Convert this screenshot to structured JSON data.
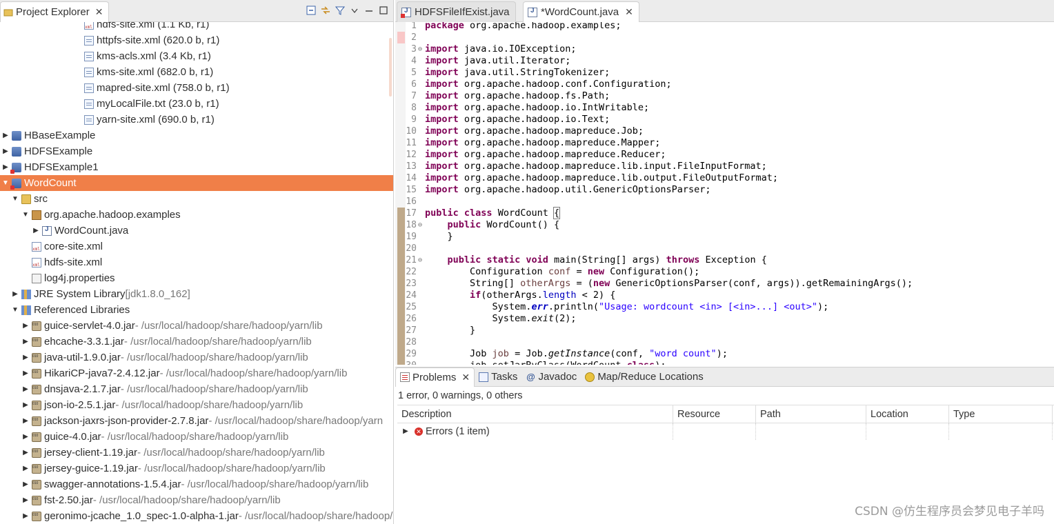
{
  "explorer": {
    "title": "Project Explorer",
    "tree": [
      {
        "indent": 105,
        "arrow": "",
        "icon": "xml",
        "name": "hdfs-site.xml (1.1 Kb, r1)",
        "suffix": ""
      },
      {
        "indent": 105,
        "arrow": "",
        "icon": "file",
        "name": "httpfs-site.xml (620.0 b, r1)",
        "suffix": ""
      },
      {
        "indent": 105,
        "arrow": "",
        "icon": "file",
        "name": "kms-acls.xml (3.4 Kb, r1)",
        "suffix": ""
      },
      {
        "indent": 105,
        "arrow": "",
        "icon": "file",
        "name": "kms-site.xml (682.0 b, r1)",
        "suffix": ""
      },
      {
        "indent": 105,
        "arrow": "",
        "icon": "file",
        "name": "mapred-site.xml (758.0 b, r1)",
        "suffix": ""
      },
      {
        "indent": 105,
        "arrow": "",
        "icon": "file",
        "name": "myLocalFile.txt (23.0 b, r1)",
        "suffix": ""
      },
      {
        "indent": 105,
        "arrow": "",
        "icon": "file",
        "name": "yarn-site.xml (690.0 b, r1)",
        "suffix": ""
      },
      {
        "indent": 0,
        "arrow": "▶",
        "icon": "project",
        "name": "HBaseExample",
        "suffix": ""
      },
      {
        "indent": 0,
        "arrow": "▶",
        "icon": "project",
        "name": "HDFSExample",
        "suffix": ""
      },
      {
        "indent": 0,
        "arrow": "▶",
        "icon": "project-err",
        "name": "HDFSExample1",
        "suffix": ""
      },
      {
        "indent": 0,
        "arrow": "▼",
        "icon": "project-err",
        "name": "WordCount",
        "suffix": "",
        "selected": true
      },
      {
        "indent": 14,
        "arrow": "▼",
        "icon": "folder",
        "name": "src",
        "suffix": ""
      },
      {
        "indent": 29,
        "arrow": "▼",
        "icon": "package",
        "name": "org.apache.hadoop.examples",
        "suffix": ""
      },
      {
        "indent": 44,
        "arrow": "▶",
        "icon": "java",
        "name": "WordCount.java",
        "suffix": ""
      },
      {
        "indent": 29,
        "arrow": "",
        "icon": "xml",
        "name": "core-site.xml",
        "suffix": ""
      },
      {
        "indent": 29,
        "arrow": "",
        "icon": "xml",
        "name": "hdfs-site.xml",
        "suffix": ""
      },
      {
        "indent": 29,
        "arrow": "",
        "icon": "props",
        "name": "log4j.properties",
        "suffix": ""
      },
      {
        "indent": 14,
        "arrow": "▶",
        "icon": "lib",
        "name": "JRE System Library ",
        "suffix": "[jdk1.8.0_162]"
      },
      {
        "indent": 14,
        "arrow": "▼",
        "icon": "lib",
        "name": "Referenced Libraries",
        "suffix": ""
      },
      {
        "indent": 29,
        "arrow": "▶",
        "icon": "jar",
        "name": "guice-servlet-4.0.jar",
        "suffix": " - /usr/local/hadoop/share/hadoop/yarn/lib"
      },
      {
        "indent": 29,
        "arrow": "▶",
        "icon": "jar",
        "name": "ehcache-3.3.1.jar",
        "suffix": " - /usr/local/hadoop/share/hadoop/yarn/lib"
      },
      {
        "indent": 29,
        "arrow": "▶",
        "icon": "jar",
        "name": "java-util-1.9.0.jar",
        "suffix": " - /usr/local/hadoop/share/hadoop/yarn/lib"
      },
      {
        "indent": 29,
        "arrow": "▶",
        "icon": "jar",
        "name": "HikariCP-java7-2.4.12.jar",
        "suffix": " - /usr/local/hadoop/share/hadoop/yarn/lib"
      },
      {
        "indent": 29,
        "arrow": "▶",
        "icon": "jar",
        "name": "dnsjava-2.1.7.jar",
        "suffix": " - /usr/local/hadoop/share/hadoop/yarn/lib"
      },
      {
        "indent": 29,
        "arrow": "▶",
        "icon": "jar",
        "name": "json-io-2.5.1.jar",
        "suffix": " - /usr/local/hadoop/share/hadoop/yarn/lib"
      },
      {
        "indent": 29,
        "arrow": "▶",
        "icon": "jar",
        "name": "jackson-jaxrs-json-provider-2.7.8.jar",
        "suffix": " - /usr/local/hadoop/share/hadoop/yarn"
      },
      {
        "indent": 29,
        "arrow": "▶",
        "icon": "jar",
        "name": "guice-4.0.jar",
        "suffix": " - /usr/local/hadoop/share/hadoop/yarn/lib"
      },
      {
        "indent": 29,
        "arrow": "▶",
        "icon": "jar",
        "name": "jersey-client-1.19.jar",
        "suffix": " - /usr/local/hadoop/share/hadoop/yarn/lib"
      },
      {
        "indent": 29,
        "arrow": "▶",
        "icon": "jar",
        "name": "jersey-guice-1.19.jar",
        "suffix": " - /usr/local/hadoop/share/hadoop/yarn/lib"
      },
      {
        "indent": 29,
        "arrow": "▶",
        "icon": "jar",
        "name": "swagger-annotations-1.5.4.jar",
        "suffix": " - /usr/local/hadoop/share/hadoop/yarn/lib"
      },
      {
        "indent": 29,
        "arrow": "▶",
        "icon": "jar",
        "name": "fst-2.50.jar",
        "suffix": " - /usr/local/hadoop/share/hadoop/yarn/lib"
      },
      {
        "indent": 29,
        "arrow": "▶",
        "icon": "jar",
        "name": "geronimo-jcache_1.0_spec-1.0-alpha-1.jar",
        "suffix": " - /usr/local/hadoop/share/hadoop/"
      }
    ]
  },
  "editor": {
    "tabs": [
      {
        "label": "HDFSFileIfExist.java",
        "active": false,
        "error": true
      },
      {
        "label": "*WordCount.java",
        "active": true,
        "error": false
      }
    ],
    "lines": [
      {
        "n": "1",
        "fold": "",
        "mark": "",
        "html": "<span class=\"kw\">package</span> org.apache.hadoop.examples;"
      },
      {
        "n": "2",
        "fold": "",
        "mark": "cur",
        "html": ""
      },
      {
        "n": "3",
        "fold": "⊖",
        "mark": "",
        "html": "<span class=\"kw\">import</span> java.io.IOException;"
      },
      {
        "n": "4",
        "fold": "",
        "mark": "",
        "html": "<span class=\"kw\">import</span> java.util.Iterator;"
      },
      {
        "n": "5",
        "fold": "",
        "mark": "",
        "html": "<span class=\"kw\">import</span> java.util.StringTokenizer;"
      },
      {
        "n": "6",
        "fold": "",
        "mark": "",
        "html": "<span class=\"kw\">import</span> org.apache.hadoop.conf.Configuration;"
      },
      {
        "n": "7",
        "fold": "",
        "mark": "",
        "html": "<span class=\"kw\">import</span> org.apache.hadoop.fs.Path;"
      },
      {
        "n": "8",
        "fold": "",
        "mark": "",
        "html": "<span class=\"kw\">import</span> org.apache.hadoop.io.IntWritable;"
      },
      {
        "n": "9",
        "fold": "",
        "mark": "",
        "html": "<span class=\"kw\">import</span> org.apache.hadoop.io.Text;"
      },
      {
        "n": "10",
        "fold": "",
        "mark": "",
        "html": "<span class=\"kw\">import</span> org.apache.hadoop.mapreduce.Job;"
      },
      {
        "n": "11",
        "fold": "",
        "mark": "",
        "html": "<span class=\"kw\">import</span> org.apache.hadoop.mapreduce.Mapper;"
      },
      {
        "n": "12",
        "fold": "",
        "mark": "",
        "html": "<span class=\"kw\">import</span> org.apache.hadoop.mapreduce.Reducer;"
      },
      {
        "n": "13",
        "fold": "",
        "mark": "",
        "html": "<span class=\"kw\">import</span> org.apache.hadoop.mapreduce.lib.input.FileInputFormat;"
      },
      {
        "n": "14",
        "fold": "",
        "mark": "",
        "html": "<span class=\"kw\">import</span> org.apache.hadoop.mapreduce.lib.output.FileOutputFormat;"
      },
      {
        "n": "15",
        "fold": "",
        "mark": "",
        "html": "<span class=\"kw\">import</span> org.apache.hadoop.util.GenericOptionsParser;"
      },
      {
        "n": "16",
        "fold": "",
        "mark": "",
        "html": ""
      },
      {
        "n": "17",
        "fold": "",
        "mark": "m",
        "html": "<span class=\"kw\">public</span> <span class=\"kw\">class</span> WordCount <span class=\"bracket\">{</span>"
      },
      {
        "n": "18",
        "fold": "⊖",
        "mark": "m",
        "html": "    <span class=\"kw\">public</span> WordCount() {"
      },
      {
        "n": "19",
        "fold": "",
        "mark": "m",
        "html": "    }"
      },
      {
        "n": "20",
        "fold": "",
        "mark": "m",
        "html": ""
      },
      {
        "n": "21",
        "fold": "⊖",
        "mark": "m",
        "html": "    <span class=\"kw\">public</span> <span class=\"kw\">static</span> <span class=\"kw\">void</span> main(String[] args) <span class=\"kw\">throws</span> Exception {"
      },
      {
        "n": "22",
        "fold": "",
        "mark": "m",
        "html": "        Configuration <span class=\"var\">conf</span> = <span class=\"kw\">new</span> Configuration();"
      },
      {
        "n": "23",
        "fold": "",
        "mark": "m",
        "html": "        String[] <span class=\"var\">otherArgs</span> = (<span class=\"kw\">new</span> GenericOptionsParser(conf, args)).getRemainingArgs();"
      },
      {
        "n": "24",
        "fold": "",
        "mark": "m",
        "html": "        <span class=\"kw\">if</span>(otherArgs.<span class=\"fld\">length</span> &lt; 2) {"
      },
      {
        "n": "25",
        "fold": "",
        "mark": "m",
        "html": "            System.<span class=\"fld it\"><b>err</b></span>.println(<span class=\"str\">\"Usage: wordcount &lt;in&gt; [&lt;in&gt;...] &lt;out&gt;\"</span>);"
      },
      {
        "n": "26",
        "fold": "",
        "mark": "m",
        "html": "            System.<span class=\"it\">exit</span>(2);"
      },
      {
        "n": "27",
        "fold": "",
        "mark": "m",
        "html": "        }"
      },
      {
        "n": "28",
        "fold": "",
        "mark": "m",
        "html": ""
      },
      {
        "n": "29",
        "fold": "",
        "mark": "m",
        "html": "        Job <span class=\"var\">job</span> = Job.<span class=\"it\">getInstance</span>(conf, <span class=\"str\">\"word count\"</span>);"
      },
      {
        "n": "30",
        "fold": "",
        "mark": "m",
        "html": "        job.setJarByClass(WordCount.<span class=\"kw\">class</span>);"
      }
    ]
  },
  "problems": {
    "tabs": [
      {
        "label": "Problems",
        "icon": "problems",
        "active": true,
        "closable": true
      },
      {
        "label": "Tasks",
        "icon": "tasks",
        "active": false,
        "closable": false
      },
      {
        "label": "Javadoc",
        "icon": "javadoc",
        "active": false,
        "closable": false
      },
      {
        "label": "Map/Reduce Locations",
        "icon": "mr",
        "active": false,
        "closable": false
      }
    ],
    "summary": "1 error, 0 warnings, 0 others",
    "columns": [
      "Description",
      "Resource",
      "Path",
      "Location",
      "Type"
    ],
    "rows": [
      {
        "description": "Errors (1 item)",
        "resource": "",
        "path": "",
        "location": "",
        "type": ""
      }
    ]
  },
  "watermark": "CSDN @仿生程序员会梦见电子羊吗"
}
